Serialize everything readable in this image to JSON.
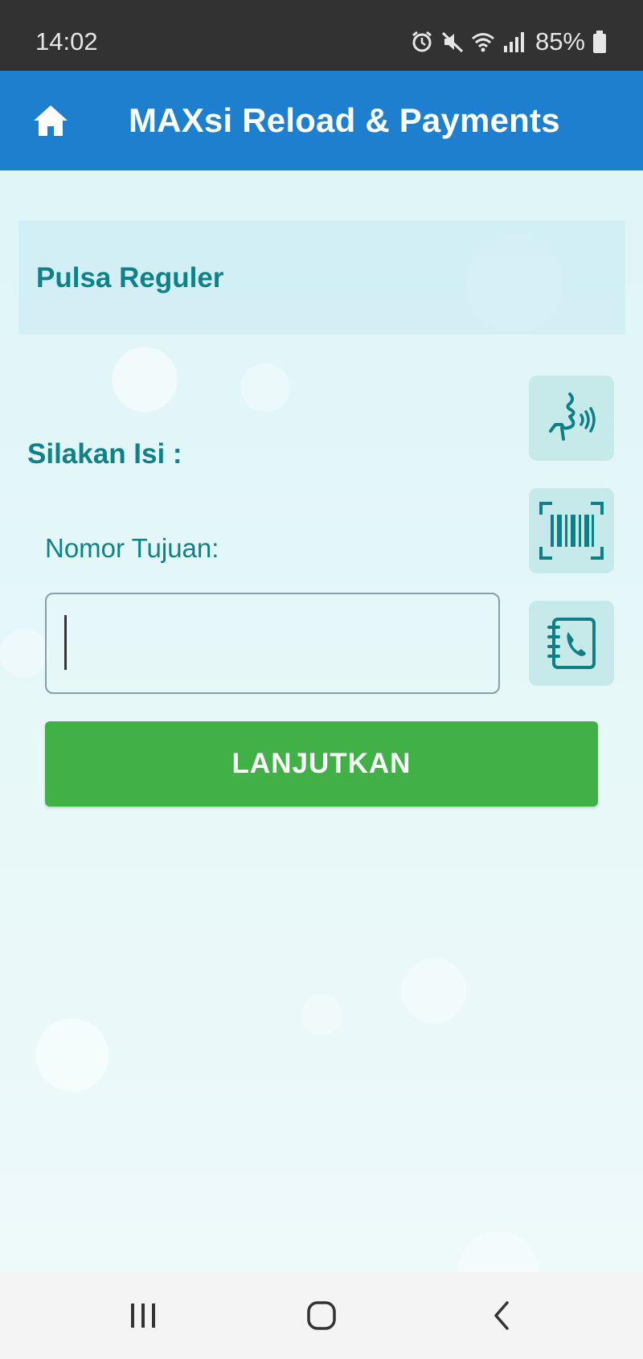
{
  "status_bar": {
    "time": "14:02",
    "battery": "85%",
    "icons": [
      "alarm-icon",
      "mute-icon",
      "wifi-icon",
      "signal-icon",
      "battery-icon"
    ]
  },
  "app_bar": {
    "title": "MAXsi Reload & Payments",
    "home_icon": "home-icon",
    "color": "#1e7fcf"
  },
  "page": {
    "section_title": "Pulsa Reguler",
    "prompt": "Silakan Isi :",
    "field_label": "Nomor Tujuan:",
    "field_value": "",
    "continue_label": "LANJUTKAN"
  },
  "side_buttons": [
    {
      "name": "voice-input-button",
      "icon": "voice-icon"
    },
    {
      "name": "barcode-scan-button",
      "icon": "barcode-icon"
    },
    {
      "name": "contacts-button",
      "icon": "contact-book-icon"
    }
  ],
  "nav_bar": {
    "icons": [
      "recent-apps-icon",
      "home-nav-icon",
      "back-icon"
    ]
  },
  "colors": {
    "accent": "#0e8288",
    "button_green": "#41b046"
  }
}
